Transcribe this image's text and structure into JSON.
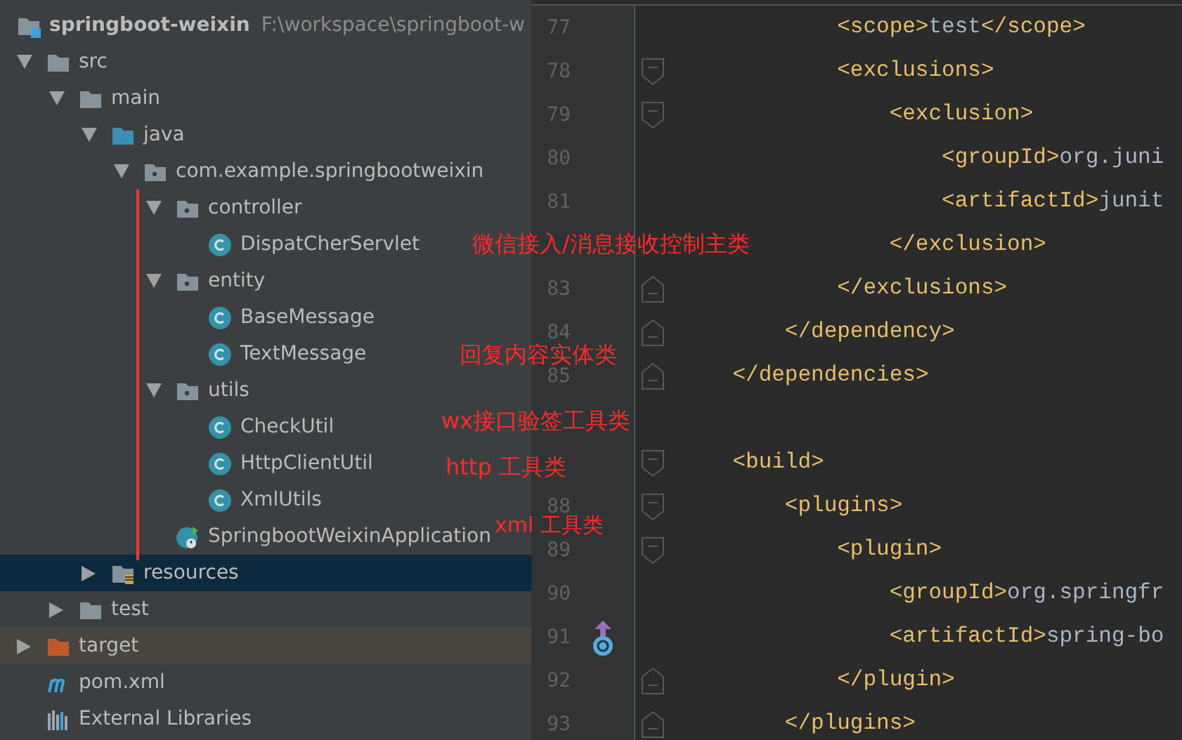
{
  "project": {
    "name": "springboot-weixin",
    "path": "F:\\workspace\\springboot-w"
  },
  "tree": [
    {
      "kind": "folder",
      "label": "src",
      "expanded": true,
      "selected": false,
      "children": [
        {
          "kind": "folder",
          "label": "main",
          "expanded": true,
          "selected": false,
          "children": [
            {
              "kind": "source-folder",
              "label": "java",
              "expanded": true,
              "selected": false,
              "children": [
                {
                  "kind": "package",
                  "label": "com.example.springbootweixin",
                  "expanded": true,
                  "selected": false,
                  "children": [
                    {
                      "kind": "package",
                      "label": "controller",
                      "expanded": true,
                      "selected": false,
                      "children": [
                        {
                          "kind": "class",
                          "label": "DispatCherServlet",
                          "selected": false
                        }
                      ]
                    },
                    {
                      "kind": "package",
                      "label": "entity",
                      "expanded": true,
                      "selected": false,
                      "children": [
                        {
                          "kind": "class",
                          "label": "BaseMessage",
                          "selected": false
                        },
                        {
                          "kind": "class",
                          "label": "TextMessage",
                          "selected": false
                        }
                      ]
                    },
                    {
                      "kind": "package",
                      "label": "utils",
                      "expanded": true,
                      "selected": false,
                      "children": [
                        {
                          "kind": "class",
                          "label": "CheckUtil",
                          "selected": false
                        },
                        {
                          "kind": "class",
                          "label": "HttpClientUtil",
                          "selected": false
                        },
                        {
                          "kind": "class",
                          "label": "XmlUtils",
                          "selected": false
                        }
                      ]
                    },
                    {
                      "kind": "app-class",
                      "label": "SpringbootWeixinApplication",
                      "selected": false
                    }
                  ]
                }
              ]
            },
            {
              "kind": "resources-folder",
              "label": "resources",
              "expanded": false,
              "selected": true
            }
          ]
        },
        {
          "kind": "folder",
          "label": "test",
          "expanded": false,
          "selected": false
        }
      ]
    },
    {
      "kind": "excluded-folder",
      "label": "target",
      "expanded": false,
      "selected": false
    },
    {
      "kind": "maven",
      "label": "pom.xml",
      "selected": false
    },
    {
      "kind": "libraries",
      "label": "External Libraries",
      "selected": false
    }
  ],
  "annotations": [
    "微信接入/消息接收控制主类",
    "回复内容实体类",
    "wx接口验签工具类",
    "http 工具类",
    "xml 工具类"
  ],
  "editor": {
    "lines": [
      {
        "number": "77",
        "kind": "plain",
        "tokens": [
          {
            "kind": "tag",
            "text": "            <scope>"
          },
          {
            "kind": "text",
            "text": "test"
          },
          {
            "kind": "tag",
            "text": "</scope>"
          }
        ]
      },
      {
        "number": "78",
        "kind": "fold-start",
        "tokens": [
          {
            "kind": "tag",
            "text": "            <exclusions>"
          }
        ]
      },
      {
        "number": "79",
        "kind": "fold-start",
        "tokens": [
          {
            "kind": "tag",
            "text": "                <exclusion>"
          }
        ]
      },
      {
        "number": "80",
        "kind": "plain",
        "tokens": [
          {
            "kind": "tag",
            "text": "                    <groupId>"
          },
          {
            "kind": "text",
            "text": "org.juni"
          }
        ]
      },
      {
        "number": "81",
        "kind": "plain",
        "tokens": [
          {
            "kind": "tag",
            "text": "                    <artifactId>"
          },
          {
            "kind": "text",
            "text": "junit"
          }
        ]
      },
      {
        "kind": "plain",
        "tokens": [
          {
            "kind": "tag",
            "text": "                </exclusion>"
          }
        ]
      },
      {
        "number": "83",
        "kind": "fold-end",
        "tokens": [
          {
            "kind": "tag",
            "text": "            </exclusions>"
          }
        ]
      },
      {
        "number": "84",
        "kind": "fold-end",
        "tokens": [
          {
            "kind": "tag",
            "text": "        </dependency>"
          }
        ]
      },
      {
        "number": "85",
        "kind": "fold-end",
        "tokens": [
          {
            "kind": "tag",
            "text": "    </dependencies>"
          }
        ]
      },
      {
        "kind": "plain"
      },
      {
        "kind": "fold-start",
        "tokens": [
          {
            "kind": "tag",
            "text": "    <build>"
          }
        ]
      },
      {
        "number": "88",
        "kind": "fold-start",
        "tokens": [
          {
            "kind": "tag",
            "text": "        <plugins>"
          }
        ]
      },
      {
        "number": "89",
        "kind": "fold-start",
        "tokens": [
          {
            "kind": "tag",
            "text": "            <plugin>"
          }
        ]
      },
      {
        "number": "90",
        "kind": "plain",
        "tokens": [
          {
            "kind": "tag",
            "text": "                <groupId>"
          },
          {
            "kind": "text",
            "text": "org.springfr"
          }
        ]
      },
      {
        "number": "91",
        "kind": "plain",
        "override": true,
        "tokens": [
          {
            "kind": "tag",
            "text": "                <artifactId>"
          },
          {
            "kind": "text",
            "text": "spring-bo"
          }
        ]
      },
      {
        "number": "92",
        "kind": "fold-end",
        "tokens": [
          {
            "kind": "tag",
            "text": "            </plugin>"
          }
        ]
      },
      {
        "number": "93",
        "kind": "fold-end",
        "tokens": [
          {
            "kind": "tag",
            "text": "        </plugins>"
          }
        ]
      }
    ]
  }
}
